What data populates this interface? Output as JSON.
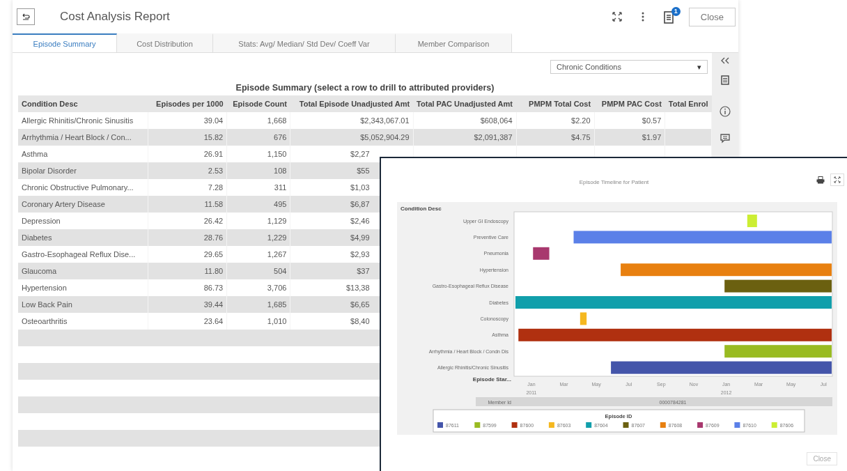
{
  "window": {
    "title": "Cost Analysis Report",
    "badge": "1",
    "close": "Close"
  },
  "tabs": [
    {
      "label": "Episode Summary",
      "selected": true
    },
    {
      "label": "Cost Distribution",
      "selected": false
    },
    {
      "label": "Stats: Avg/ Median/ Std Dev/ Coeff Var",
      "selected": false
    },
    {
      "label": "Member Comparison",
      "selected": false
    }
  ],
  "filter": {
    "value": "Chronic Conditions",
    "caret": "▾"
  },
  "table": {
    "caption": "Episode Summary (select a row to drill to attributed providers)",
    "columns": [
      "Condition Desc",
      "Episodes per 1000",
      "Episode Count",
      "Total Episode Unadjusted Amt",
      "Total PAC Unadjusted Amt",
      "PMPM Total Cost",
      "PMPM PAC Cost",
      "Total Enrol"
    ],
    "rows": [
      {
        "cells": [
          "Allergic Rhinitis/Chronic Sinusitis",
          "39.04",
          "1,668",
          "$2,343,067.01",
          "$608,064",
          "$2.20",
          "$0.57"
        ]
      },
      {
        "cells": [
          "Arrhythmia / Heart Block / Con...",
          "15.82",
          "676",
          "$5,052,904.29",
          "$2,091,387",
          "$4.75",
          "$1.97"
        ]
      },
      {
        "cells": [
          "Asthma",
          "26.91",
          "1,150",
          "$2,27"
        ]
      },
      {
        "cells": [
          "Bipolar Disorder",
          "2.53",
          "108",
          "$55"
        ]
      },
      {
        "cells": [
          "Chronic Obstructive Pulmonary...",
          "7.28",
          "311",
          "$1,03"
        ]
      },
      {
        "cells": [
          "Coronary Artery Disease",
          "11.58",
          "495",
          "$6,87"
        ]
      },
      {
        "cells": [
          "Depression",
          "26.42",
          "1,129",
          "$2,46"
        ]
      },
      {
        "cells": [
          "Diabetes",
          "28.76",
          "1,229",
          "$4,99"
        ]
      },
      {
        "cells": [
          "Gastro-Esophageal Reflux Dise...",
          "29.65",
          "1,267",
          "$2,93"
        ]
      },
      {
        "cells": [
          "Glaucoma",
          "11.80",
          "504",
          "$37"
        ]
      },
      {
        "cells": [
          "Hypertension",
          "86.73",
          "3,706",
          "$13,38"
        ]
      },
      {
        "cells": [
          "Low Back Pain",
          "39.44",
          "1,685",
          "$6,65"
        ]
      },
      {
        "cells": [
          "Osteoarthritis",
          "23.64",
          "1,010",
          "$8,40"
        ]
      }
    ]
  },
  "popup": {
    "title": "Episode Timeline for Patient",
    "close": "Close",
    "chart": {
      "axis_title": "Condition Desc",
      "x_title": "Episode Star...",
      "rows": [
        {
          "label": "Upper GI Endoscopy",
          "color": "#ccee33"
        },
        {
          "label": "Preventive Care",
          "color": "#5b80e8"
        },
        {
          "label": "Pneumonia",
          "color": "#a8386e"
        },
        {
          "label": "Hypertension",
          "color": "#e88010"
        },
        {
          "label": "Gastro-Esophageal Reflux Disease",
          "color": "#6b6010"
        },
        {
          "label": "Diabetes",
          "color": "#119fab"
        },
        {
          "label": "Colonoscopy",
          "color": "#f5b820"
        },
        {
          "label": "Asthma",
          "color": "#b03010"
        },
        {
          "label": "Arrhythmia / Heart Block / Condn Dis",
          "color": "#99bb22"
        },
        {
          "label": "Allergic Rhinitis/Chronic Sinusitis",
          "color": "#4455aa"
        }
      ],
      "xticks": [
        {
          "label": "Jan",
          "year": "2011"
        },
        {
          "label": "Mar"
        },
        {
          "label": "May"
        },
        {
          "label": "Jul"
        },
        {
          "label": "Sep"
        },
        {
          "label": "Nov"
        },
        {
          "label": "Jan",
          "year": "2012"
        },
        {
          "label": "Mar"
        },
        {
          "label": "May"
        },
        {
          "label": "Jul"
        }
      ],
      "member_label": "Member Id",
      "member_value": "0000784281",
      "legend_title": "Episode ID",
      "legend": [
        {
          "label": "87611",
          "color": "#4455aa"
        },
        {
          "label": "87599",
          "color": "#99bb22"
        },
        {
          "label": "87600",
          "color": "#b03010"
        },
        {
          "label": "87603",
          "color": "#f5b820"
        },
        {
          "label": "87604",
          "color": "#119fab"
        },
        {
          "label": "87607",
          "color": "#6b6010"
        },
        {
          "label": "87608",
          "color": "#e88010"
        },
        {
          "label": "87609",
          "color": "#a8386e"
        },
        {
          "label": "87610",
          "color": "#5b80e8"
        },
        {
          "label": "87606",
          "color": "#ccee33"
        }
      ]
    }
  }
}
